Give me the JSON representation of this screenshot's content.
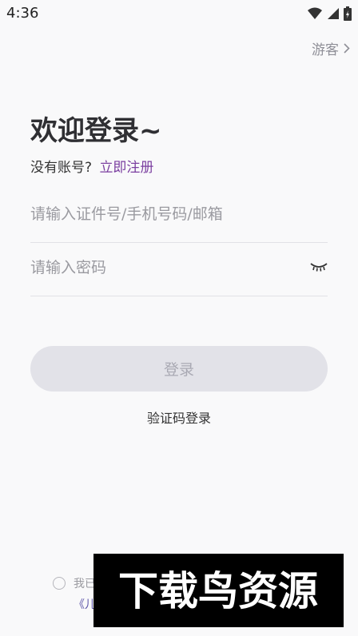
{
  "status": {
    "time": "4:36"
  },
  "header": {
    "guest_label": "游客"
  },
  "welcome": {
    "title": "欢迎登录~"
  },
  "register": {
    "prompt": "没有账号?",
    "link": "立即注册"
  },
  "form": {
    "id_placeholder": "请输入证件号/手机号码/邮箱",
    "password_placeholder": "请输入密码",
    "login_label": "登录",
    "sms_login_label": "验证码登录"
  },
  "agreement": {
    "prefix": "我已",
    "line2": "《儿"
  },
  "colors": {
    "accent": "#7b3fa0",
    "button_bg": "#e2e2e8",
    "page_bg": "#f9f9fa"
  },
  "watermark_text": "下载鸟资源"
}
